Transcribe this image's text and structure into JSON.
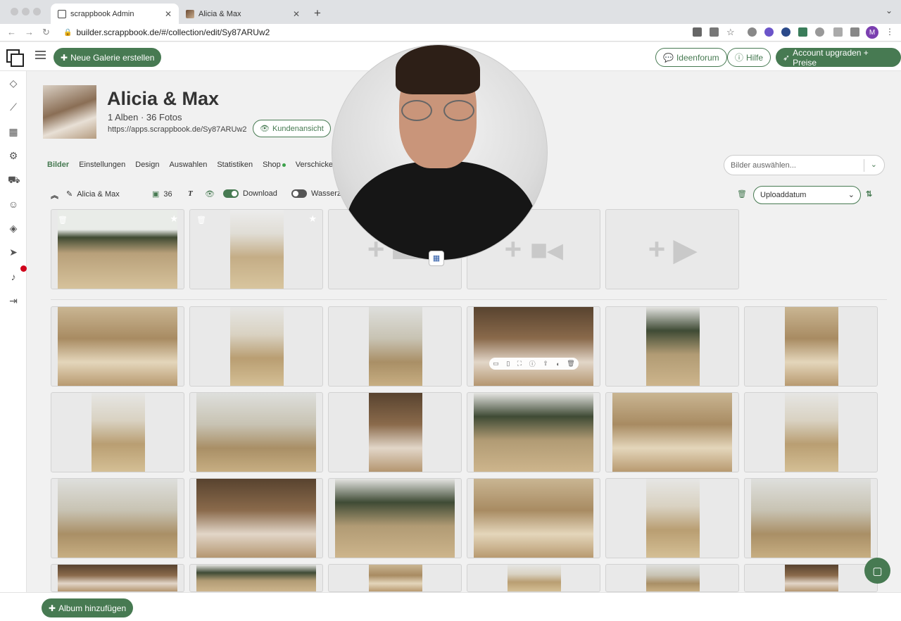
{
  "browser": {
    "tabs": [
      {
        "label": "scrappbook Admin",
        "active": true
      },
      {
        "label": "Alicia & Max",
        "active": false
      }
    ],
    "url": "builder.scrappbook.de/#/collection/edit/Sy87ARUw2",
    "profile_initial": "M"
  },
  "header": {
    "create_gallery_label": "Neue Galerie erstellen",
    "ideas_forum_label": "Ideenforum",
    "help_label": "Hilfe",
    "upgrade_label": "Account upgraden + Preise"
  },
  "sidebar": {
    "icons": [
      "diamond-icon",
      "chart-icon",
      "grid-icon",
      "settings-icon",
      "cart-icon",
      "user-icon",
      "gem-icon",
      "send-icon",
      "bell-icon",
      "logout-icon"
    ]
  },
  "gallery": {
    "title": "Alicia & Max",
    "meta": "1 Alben · 36 Fotos",
    "url": "https://apps.scrappbook.de/Sy87ARUw2",
    "customer_view_label": "Kundenansicht"
  },
  "tabs": [
    "Bilder",
    "Einstellungen",
    "Design",
    "Auswahlen",
    "Statistiken",
    "Shop",
    "Verschicken"
  ],
  "select_images_placeholder": "Bilder auswählen...",
  "toolbar": {
    "album_name": "Alicia & Max",
    "image_count": "36",
    "download_label": "Download",
    "download_enabled": true,
    "watermark_label": "Wasserz",
    "watermark_enabled": false,
    "sort_value": "Uploaddatum"
  },
  "featured_tiles": [
    {
      "kind": "photo",
      "orientation": "landscape"
    },
    {
      "kind": "photo",
      "orientation": "portrait"
    },
    {
      "kind": "add-image",
      "label": "+"
    },
    {
      "kind": "add-video",
      "label": "+"
    },
    {
      "kind": "add-video-link",
      "label": "+"
    }
  ],
  "photo_rows": [
    [
      "land",
      "port",
      "port",
      "land",
      "port",
      "port"
    ],
    [
      "port",
      "land",
      "port",
      "land",
      "land",
      "port"
    ],
    [
      "land",
      "land",
      "land",
      "land",
      "port",
      "land"
    ],
    [
      "land",
      "land",
      "port",
      "port",
      "port",
      "port"
    ]
  ],
  "colors": {
    "accent_green": "#477a52",
    "notification_red": "#d0021b"
  },
  "add_album_label": "Album hinzufügen"
}
